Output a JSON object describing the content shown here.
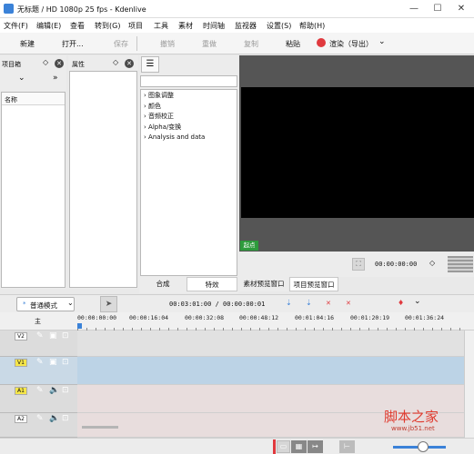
{
  "window": {
    "title": "无标题 / HD 1080p 25 fps - Kdenlive"
  },
  "menu": [
    "文件(F)",
    "编辑(E)",
    "查看",
    "转到(G)",
    "项目",
    "工具",
    "素材",
    "时间轴",
    "监视器",
    "设置(S)",
    "帮助(H)"
  ],
  "toolbar": {
    "new": "新建",
    "open": "打开...",
    "save": "保存",
    "undo": "撤销",
    "redo": "重做",
    "copy": "复制",
    "paste": "粘贴",
    "render": "渲染（导出）"
  },
  "project_bin": {
    "title": "项目箱",
    "column_name": "名称"
  },
  "properties": {
    "title": "属性"
  },
  "effects": {
    "items": [
      "图象调整",
      "颜色",
      "音频校正",
      "Alpha/变换",
      "Analysis and data"
    ],
    "tab_compose": "合成",
    "tab_effects": "特效"
  },
  "monitor": {
    "in_point": "起点",
    "timecode": "00:00:00:00",
    "tab_clip": "素材预览窗口",
    "tab_project": "项目预览窗口"
  },
  "timeline": {
    "edit_mode": "普通模式",
    "position": "00:03:01:00 / 00:00:00:01",
    "master": "主",
    "ruler": [
      "00:00:00:00",
      "00:00:16:04",
      "00:00:32:08",
      "00:00:48:12",
      "00:01:04:16",
      "00:01:20:19",
      "00:01:36:24"
    ],
    "tracks": [
      {
        "name": "V2",
        "color": "#e1e1e1"
      },
      {
        "name": "V1",
        "color": "#bcd3e6"
      },
      {
        "name": "A1",
        "color": "#e8dddd"
      },
      {
        "name": "A2",
        "color": "#e8dddd"
      }
    ]
  },
  "watermark": {
    "text": "脚本之家",
    "url": "www.jb51.net"
  },
  "colors": {
    "accent": "#3b82d8",
    "render_red": "#e0393e",
    "monitor_bg": "#000000",
    "in_point_green": "#2e9b3c"
  }
}
